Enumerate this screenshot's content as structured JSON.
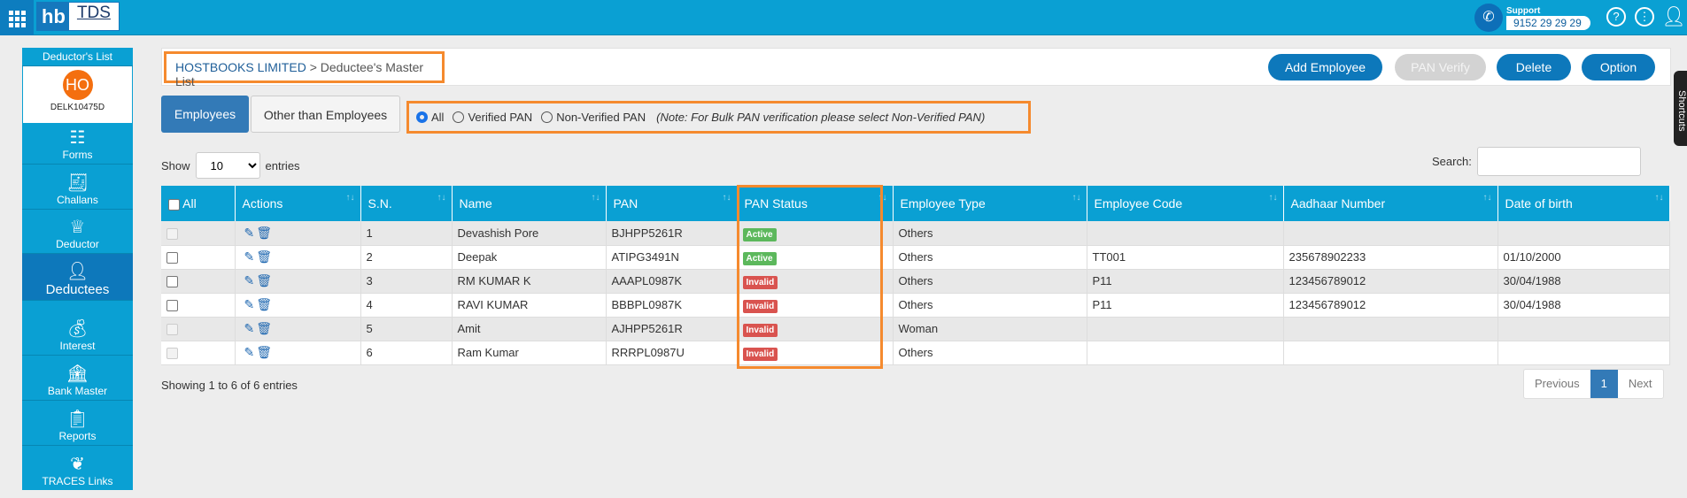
{
  "header": {
    "logo_hb": "hb",
    "logo_tds": "TDS",
    "support_label": "Support",
    "support_phone": "9152 29 29 29"
  },
  "colors": {
    "topbar": "#0aa0d3",
    "primary": "#0d78bb",
    "active_badge": "#5cb85c",
    "invalid_badge": "#d9534f",
    "highlight": "#f58a2e"
  },
  "sidebar": {
    "title": "Deductor's List",
    "avatar": "HO",
    "deductor_code": "DELK10475D",
    "items": [
      {
        "label": "Forms",
        "icon": "forms-icon"
      },
      {
        "label": "Challans",
        "icon": "challan-icon"
      },
      {
        "label": "Deductor",
        "icon": "crown-icon"
      },
      {
        "label": "Deductees",
        "icon": "person-icon",
        "active": true
      },
      {
        "label": "Interest",
        "icon": "money-bag-icon"
      },
      {
        "label": "Bank Master",
        "icon": "bank-icon"
      },
      {
        "label": "Reports",
        "icon": "report-icon"
      },
      {
        "label": "TRACES Links",
        "icon": "traces-icon"
      }
    ]
  },
  "breadcrumb": {
    "company": "HOSTBOOKS LIMITED",
    "separator": ">",
    "page": "Deductee's Master List"
  },
  "toolbar": {
    "add": "Add Employee",
    "verify": "PAN Verify",
    "delete": "Delete",
    "option": "Option"
  },
  "tabs": [
    "Employees",
    "Other than Employees"
  ],
  "filter": {
    "all": "All",
    "verified": "Verified PAN",
    "non_verified": "Non-Verified PAN",
    "selected": "All",
    "note_open": "(",
    "note": "Note: For Bulk PAN verification please select Non-Verified PAN",
    "note_close": ")"
  },
  "length": {
    "show": "Show",
    "value": "10",
    "entries": "entries"
  },
  "search": {
    "label": "Search:",
    "value": ""
  },
  "table": {
    "columns": [
      "All",
      "Actions",
      "S.N.",
      "Name",
      "PAN",
      "PAN Status",
      "Employee Type",
      "Employee Code",
      "Aadhaar Number",
      "Date of birth"
    ],
    "rows": [
      {
        "sn": "1",
        "name": "Devashish Pore",
        "pan": "BJHPP5261R",
        "status": "Active",
        "type": "Others",
        "code": "",
        "aadhaar": "",
        "dob": "",
        "disabled": true
      },
      {
        "sn": "2",
        "name": "Deepak",
        "pan": "ATIPG3491N",
        "status": "Active",
        "type": "Others",
        "code": "TT001",
        "aadhaar": "235678902233",
        "dob": "01/10/2000",
        "disabled": false
      },
      {
        "sn": "3",
        "name": "RM KUMAR K",
        "pan": "AAAPL0987K",
        "status": "Invalid",
        "type": "Others",
        "code": "P11",
        "aadhaar": "123456789012",
        "dob": "30/04/1988",
        "disabled": false
      },
      {
        "sn": "4",
        "name": "RAVI KUMAR",
        "pan": "BBBPL0987K",
        "status": "Invalid",
        "type": "Others",
        "code": "P11",
        "aadhaar": "123456789012",
        "dob": "30/04/1988",
        "disabled": false
      },
      {
        "sn": "5",
        "name": "Amit",
        "pan": "AJHPP5261R",
        "status": "Invalid",
        "type": "Woman",
        "code": "",
        "aadhaar": "",
        "dob": "",
        "disabled": true
      },
      {
        "sn": "6",
        "name": "Ram Kumar",
        "pan": "RRRPL0987U",
        "status": "Invalid",
        "type": "Others",
        "code": "",
        "aadhaar": "",
        "dob": "",
        "disabled": true
      }
    ]
  },
  "info": "Showing 1 to 6 of 6 entries",
  "pager": {
    "prev": "Previous",
    "current": "1",
    "next": "Next"
  },
  "shortcuts": "Shortcuts"
}
